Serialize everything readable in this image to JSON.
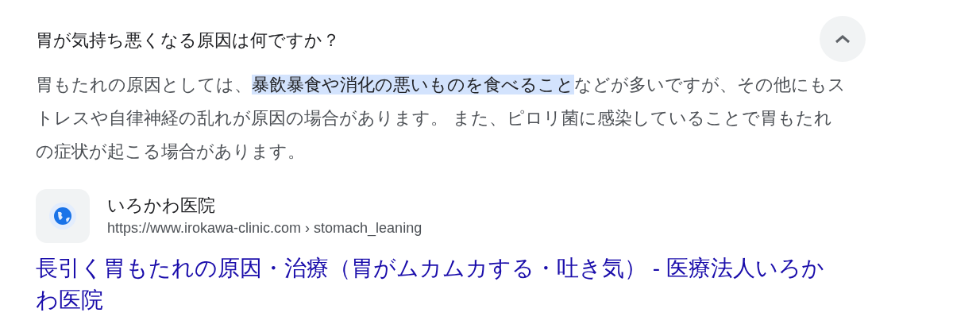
{
  "question": {
    "text": "胃が気持ち悪くなる原因は何ですか？",
    "expanded": true
  },
  "answer": [
    {
      "text": "胃もたれの原因としては、",
      "highlighted": false
    },
    {
      "text": "暴飲暴食や消化の悪いものを食べること",
      "highlighted": true
    },
    {
      "text": "などが多いですが、その他にもストレスや自律神経の乱れが原因の場合があります。 また、ピロリ菌に感染していることで胃もたれの症状が起こる場合があります。",
      "highlighted": false
    }
  ],
  "source": {
    "site_name": "いろかわ医院",
    "url": "https://www.irokawa-clinic.com › stomach_leaning",
    "title": "長引く胃もたれの原因・治療（胃がムカムカする・吐き気） - 医療法人いろかわ医院"
  }
}
